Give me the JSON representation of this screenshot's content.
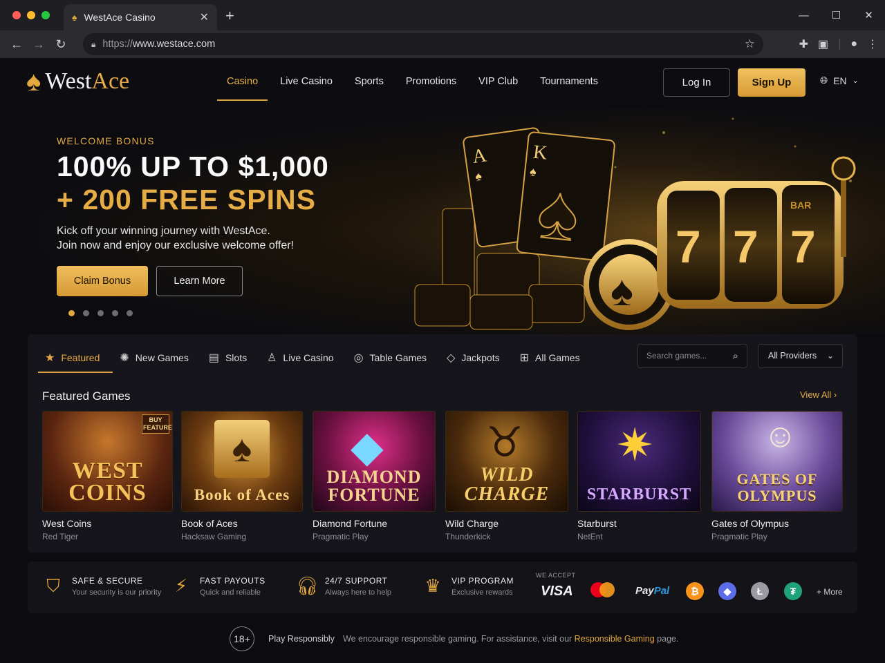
{
  "browser": {
    "tab_title": "WestAce Casino",
    "url_scheme": "https://",
    "url_host": "www.westace.com"
  },
  "header": {
    "logo_west": "West",
    "logo_ace": "Ace",
    "nav": [
      "Casino",
      "Live Casino",
      "Sports",
      "Promotions",
      "VIP Club",
      "Tournaments"
    ],
    "active_nav": "Casino",
    "login_label": "Log In",
    "signup_label": "Sign Up",
    "language": "EN"
  },
  "hero": {
    "kicker": "WELCOME BONUS",
    "headline_1": "100% UP TO $1,000",
    "headline_2": "+ 200 FREE SPINS",
    "sub_1": "Kick off your winning journey with WestAce.",
    "sub_2": "Join now and enjoy our exclusive welcome offer!",
    "claim_label": "Claim Bonus",
    "learn_label": "Learn More",
    "slides": 5,
    "active_slide": 1,
    "art_card_1": "A",
    "art_card_2": "K",
    "art_reel": "7",
    "art_bar": "BAR"
  },
  "games": {
    "categories": [
      {
        "label": "Featured",
        "icon": "star-icon",
        "active": true
      },
      {
        "label": "New Games",
        "icon": "new-badge-icon"
      },
      {
        "label": "Slots",
        "icon": "slot-machine-icon"
      },
      {
        "label": "Live Casino",
        "icon": "user-icon"
      },
      {
        "label": "Table Games",
        "icon": "chip-icon"
      },
      {
        "label": "Jackpots",
        "icon": "diamond-icon"
      },
      {
        "label": "All Games",
        "icon": "grid-icon"
      }
    ],
    "search_placeholder": "Search games...",
    "provider_filter": "All Providers",
    "section_title": "Featured Games",
    "view_all": "View All",
    "list": [
      {
        "name": "West Coins",
        "provider": "Red Tiger",
        "art": "WEST COINS",
        "badge": "BUY FEATURE"
      },
      {
        "name": "Book of Aces",
        "provider": "Hacksaw Gaming",
        "art": "Book of Aces"
      },
      {
        "name": "Diamond Fortune",
        "provider": "Pragmatic Play",
        "art": "DIAMOND FORTUNE"
      },
      {
        "name": "Wild Charge",
        "provider": "Thunderkick",
        "art": "WILD CHARGE"
      },
      {
        "name": "Starburst",
        "provider": "NetEnt",
        "art": "STARBURST"
      },
      {
        "name": "Gates of Olympus",
        "provider": "Pragmatic Play",
        "art": "GATES OF OLYMPUS"
      }
    ]
  },
  "features": [
    {
      "title": "SAFE & SECURE",
      "sub": "Your security is our priority",
      "icon": "shield-check-icon"
    },
    {
      "title": "FAST PAYOUTS",
      "sub": "Quick and reliable",
      "icon": "lightning-icon"
    },
    {
      "title": "24/7 SUPPORT",
      "sub": "Always here to help",
      "icon": "headset-icon"
    },
    {
      "title": "VIP PROGRAM",
      "sub": "Exclusive rewards",
      "icon": "crown-icon"
    }
  ],
  "payments": {
    "label": "WE ACCEPT",
    "visa": "VISA",
    "paypal_1": "Pay",
    "paypal_2": "Pal",
    "more": "+ More",
    "icons": [
      "visa-icon",
      "mastercard-icon",
      "paypal-icon",
      "bitcoin-icon",
      "ethereum-icon",
      "litecoin-icon",
      "tether-icon"
    ]
  },
  "responsible": {
    "age": "18+",
    "title": "Play Responsibly",
    "text": "We encourage responsible gaming. For assistance, visit our ",
    "link": "Responsible Gaming",
    "tail": " page."
  },
  "colors": {
    "accent": "#e0a640",
    "background": "#0c0c10",
    "panel": "#15151b"
  }
}
